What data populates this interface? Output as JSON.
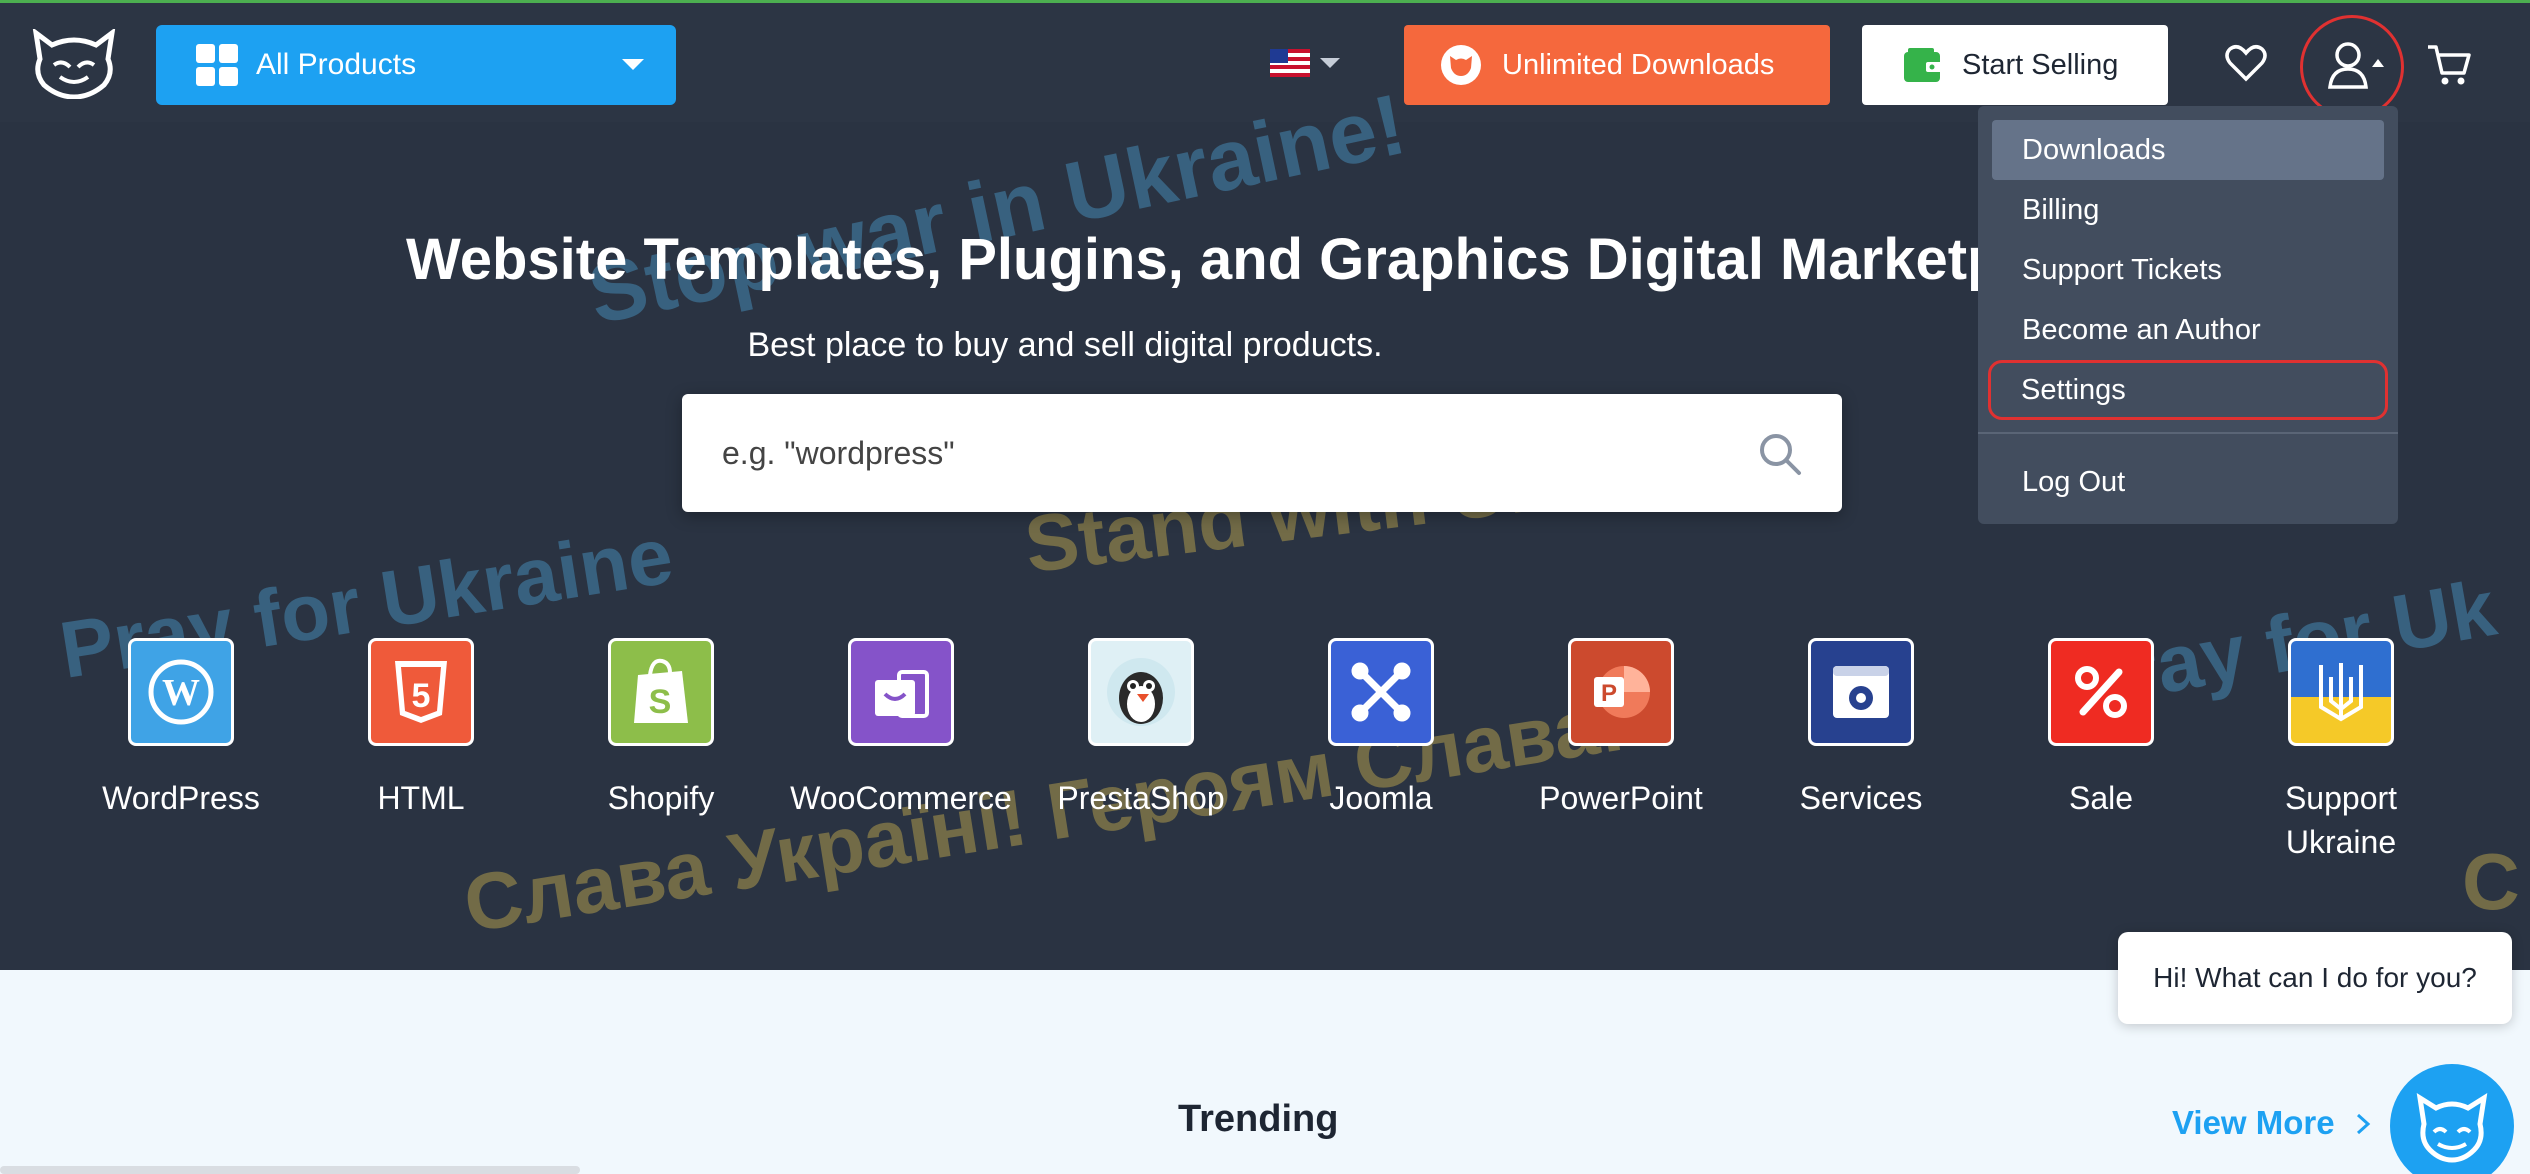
{
  "header": {
    "all_products_label": "All Products",
    "unlimited_label": "Unlimited Downloads",
    "start_selling_label": "Start Selling"
  },
  "hero": {
    "title": "Website Templates, Plugins, and Graphics Digital Marketp",
    "subtitle": "Best place to buy and sell digital products.",
    "search_placeholder": "e.g. \"wordpress\""
  },
  "watermark": {
    "line1": "Stop war in Ukraine!",
    "line2": "Stand with Ukraine",
    "line3": "Pray for Ukraine",
    "line4": "Pray for Uk",
    "line5": "Слава Україні! Героям Слава!",
    "line6": "С"
  },
  "categories": [
    {
      "label": "WordPress",
      "icon": "wordpress-icon",
      "color": "#3fa3e6"
    },
    {
      "label": "HTML",
      "icon": "html5-icon",
      "color": "#ef5a3a"
    },
    {
      "label": "Shopify",
      "icon": "shopify-icon",
      "color": "#8dbe4a"
    },
    {
      "label": "WooCommerce",
      "icon": "woocommerce-icon",
      "color": "#8553c9"
    },
    {
      "label": "PrestaShop",
      "icon": "prestashop-icon",
      "color": "#dff0f5"
    },
    {
      "label": "Joomla",
      "icon": "joomla-icon",
      "color": "#3a61d6"
    },
    {
      "label": "PowerPoint",
      "icon": "powerpoint-icon",
      "color": "#cc4a2e"
    },
    {
      "label": "Services",
      "icon": "services-icon",
      "color": "#27418f"
    },
    {
      "label": "Sale",
      "icon": "sale-icon",
      "color": "#ef2b22"
    },
    {
      "label": "Support Ukraine",
      "icon": "ukraine-trident-icon",
      "color": "#f5c928"
    }
  ],
  "dropdown": {
    "items": [
      "Downloads",
      "Billing",
      "Support Tickets",
      "Become an Author",
      "Settings"
    ],
    "logout": "Log Out"
  },
  "lower": {
    "trending": "Trending",
    "view_more": "View More"
  },
  "chat": {
    "message": "Hi! What can I do for you?"
  },
  "colors": {
    "header_bg": "#2c3544",
    "accent_blue": "#1da1f2",
    "accent_orange": "#f5683d",
    "highlight_red": "#e03131"
  }
}
